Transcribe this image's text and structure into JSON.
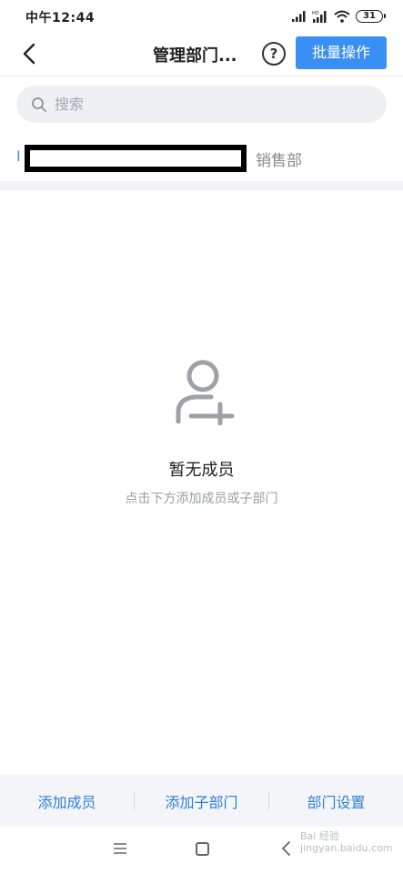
{
  "status_bar": {
    "time": "中午12:44",
    "battery": "31"
  },
  "header": {
    "title": "管理部门...",
    "help_symbol": "?",
    "batch_label": "批量操作"
  },
  "search": {
    "placeholder": "搜索"
  },
  "breadcrumb": {
    "first": "I",
    "current": "销售部"
  },
  "empty_state": {
    "title": "暂无成员",
    "description": "点击下方添加成员或子部门"
  },
  "toolbar": {
    "add_member": "添加成员",
    "add_subdept": "添加子部门",
    "dept_settings": "部门设置"
  },
  "watermark": {
    "line1": "Bai 经验",
    "line2": "jingyan.baidu.com"
  },
  "colors": {
    "accent": "#3a8ff5",
    "toolbar_text": "#2f7fd6"
  }
}
